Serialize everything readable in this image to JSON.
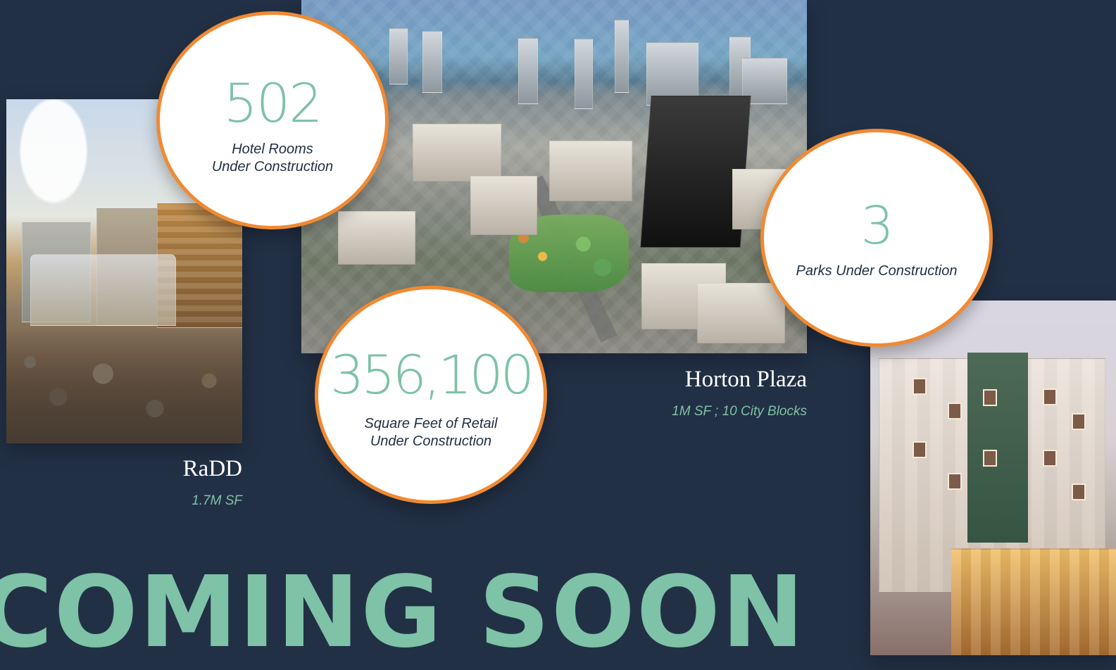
{
  "stats": [
    {
      "number": "502",
      "label_line1": "Hotel Rooms",
      "label_line2": "Under Construction"
    },
    {
      "number": "356,100",
      "label_line1": "Square Feet of Retail",
      "label_line2": "Under Construction"
    },
    {
      "number": "3",
      "label_line1": "Parks Under Construction"
    }
  ],
  "projects": {
    "radd": {
      "title": "RaDD",
      "subtitle": "1.7M SF"
    },
    "horton_plaza": {
      "title": "Horton Plaza",
      "subtitle": "1M SF ; 10 City Blocks"
    }
  },
  "headline": "COMING SOON",
  "colors": {
    "background": "#223045",
    "accent_orange": "#f08a33",
    "accent_teal": "#7ec2a7",
    "text_dark": "#223045",
    "text_light": "#ffffff"
  }
}
